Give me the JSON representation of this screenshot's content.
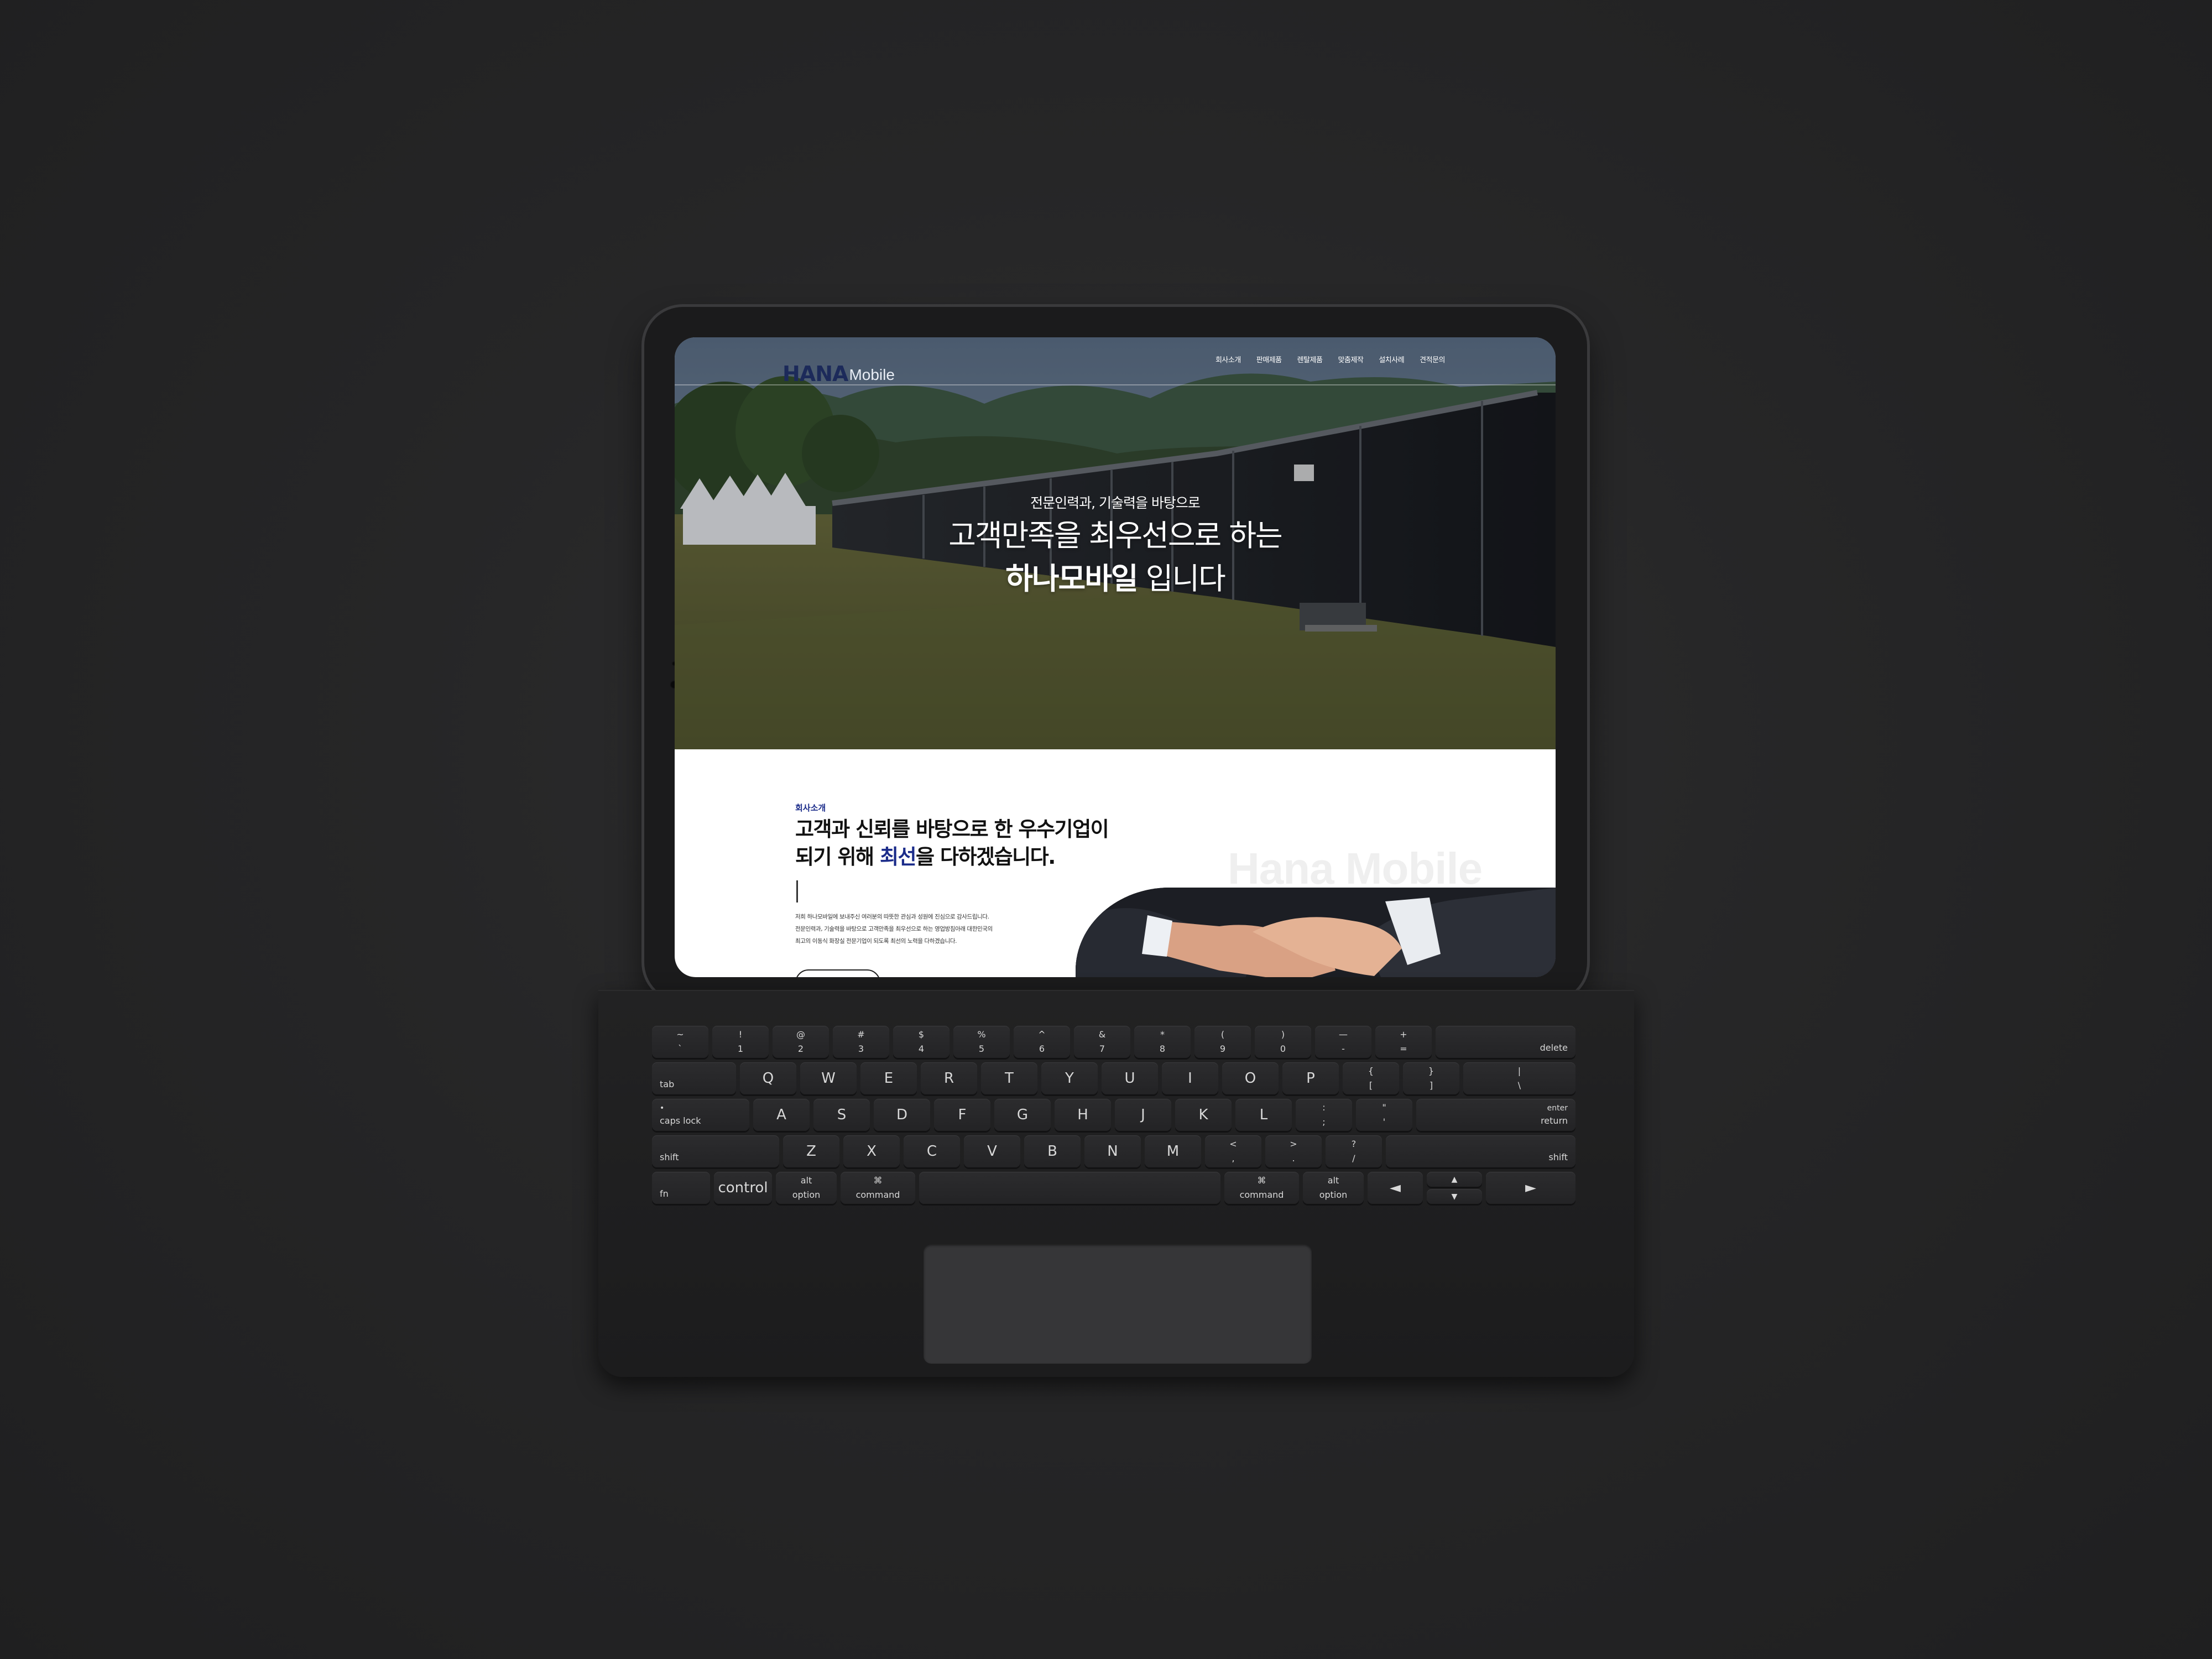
{
  "header": {
    "logo_mark": "HANA",
    "logo_word": "Mobile",
    "nav": [
      "회사소개",
      "판매제품",
      "렌탈제품",
      "맞춤제작",
      "설치사례",
      "견적문의"
    ]
  },
  "hero": {
    "subtitle": "전문인력과, 기술력을 바탕으로",
    "title_line1": "고객만족을 최우선으로 하는",
    "title_bold": "하나모바일",
    "title_rest": " 입니다"
  },
  "about": {
    "eyebrow": "회사소개",
    "title_line1": "고객과 신뢰를 바탕으로 한 우수기업이",
    "title_line2_pre": "되기 위해 ",
    "title_line2_hl": "최선",
    "title_line2_post": "을 다하겠습니다.",
    "body_lines": [
      "저희 하나모바일에 보내주신 여러분의 따뜻한 관심과 성원에 진심으로 감사드립니다.",
      "전문인력과, 기술력을 바탕으로 고객만족을 최우선으로 하는 영업방침아래 대한민국의",
      "최고의 이동식 화장실 전문기업이 되도록 최선의 노력을 다하겠습니다."
    ],
    "watermark": "Hana Mobile"
  },
  "keyboard": {
    "row1": [
      [
        "~",
        "`"
      ],
      [
        "!",
        "1"
      ],
      [
        "@",
        "2"
      ],
      [
        "#",
        "3"
      ],
      [
        "$",
        "4"
      ],
      [
        "%",
        "5"
      ],
      [
        "^",
        "6"
      ],
      [
        "&",
        "7"
      ],
      [
        "*",
        "8"
      ],
      [
        "(",
        "9"
      ],
      [
        ")",
        "0"
      ],
      [
        "—",
        "-"
      ],
      [
        "+",
        "="
      ]
    ],
    "row1_end": "delete",
    "row2_start": "tab",
    "row2": [
      "Q",
      "W",
      "E",
      "R",
      "T",
      "Y",
      "U",
      "I",
      "O",
      "P"
    ],
    "row2_sym": [
      [
        "{",
        "["
      ],
      [
        "}",
        "]"
      ],
      [
        "|",
        "\\"
      ]
    ],
    "row3_start": "caps lock",
    "row3": [
      "A",
      "S",
      "D",
      "F",
      "G",
      "H",
      "J",
      "K",
      "L"
    ],
    "row3_sym": [
      [
        ":",
        ";"
      ],
      [
        "\"",
        "'"
      ]
    ],
    "row3_end_top": "enter",
    "row3_end": "return",
    "row4_start": "shift",
    "row4": [
      "Z",
      "X",
      "C",
      "V",
      "B",
      "N",
      "M"
    ],
    "row4_sym": [
      [
        "<",
        ","
      ],
      [
        ">",
        "."
      ],
      [
        "?",
        "/"
      ]
    ],
    "row4_end": "shift",
    "fn": "fn",
    "control": "control",
    "alt": "alt",
    "option": "option",
    "cmd_symbol": "⌘",
    "command": "command",
    "arrow_left": "◄",
    "arrow_up": "▲",
    "arrow_down": "▼",
    "arrow_right": "►"
  }
}
